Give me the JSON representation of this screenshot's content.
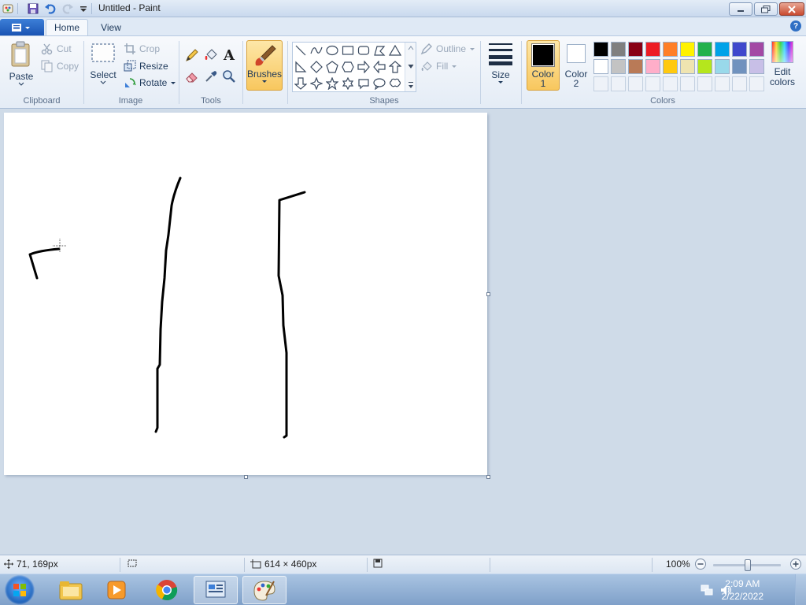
{
  "window": {
    "title": "Untitled - Paint",
    "controls": {
      "minimize": "minimize",
      "restore": "restore",
      "close": "close"
    }
  },
  "tabs": {
    "file_menu": "file-menu",
    "home": "Home",
    "view": "View"
  },
  "ribbon": {
    "clipboard": {
      "label": "Clipboard",
      "paste": "Paste",
      "cut": "Cut",
      "copy": "Copy"
    },
    "image": {
      "label": "Image",
      "select": "Select",
      "crop": "Crop",
      "resize": "Resize",
      "rotate": "Rotate"
    },
    "tools": {
      "label": "Tools"
    },
    "brushes": {
      "label": "Brushes"
    },
    "shapes": {
      "label": "Shapes",
      "outline": "Outline",
      "fill": "Fill"
    },
    "size": {
      "label": "Size"
    },
    "colors": {
      "label": "Colors",
      "color1_label": "Color",
      "color1_num": "1",
      "color2_label": "Color",
      "color2_num": "2",
      "color1_value": "#000000",
      "color2_value": "#ffffff",
      "edit_colors_1": "Edit",
      "edit_colors_2": "colors",
      "palette_row1": [
        "#000000",
        "#7f7f7f",
        "#880015",
        "#ed1c24",
        "#ff7f27",
        "#fff200",
        "#22b14c",
        "#00a2e8",
        "#3f48cc",
        "#a349a4"
      ],
      "palette_row2": [
        "#ffffff",
        "#c3c3c3",
        "#b97a57",
        "#ffaec9",
        "#ffc90e",
        "#efe4b0",
        "#b5e61d",
        "#99d9ea",
        "#7092be",
        "#c8bfe7"
      ]
    }
  },
  "statusbar": {
    "cursor_pos": "71, 169px",
    "selection_size": "",
    "canvas_size": "614 × 460px",
    "zoom": "100%",
    "zoom_level": 100
  },
  "taskbar": {
    "time": "2:09 AM",
    "date": "2/22/2022",
    "apps": [
      "explorer-icon",
      "media-player-icon",
      "chrome-icon",
      "control-panel-icon",
      "paint-icon"
    ]
  }
}
